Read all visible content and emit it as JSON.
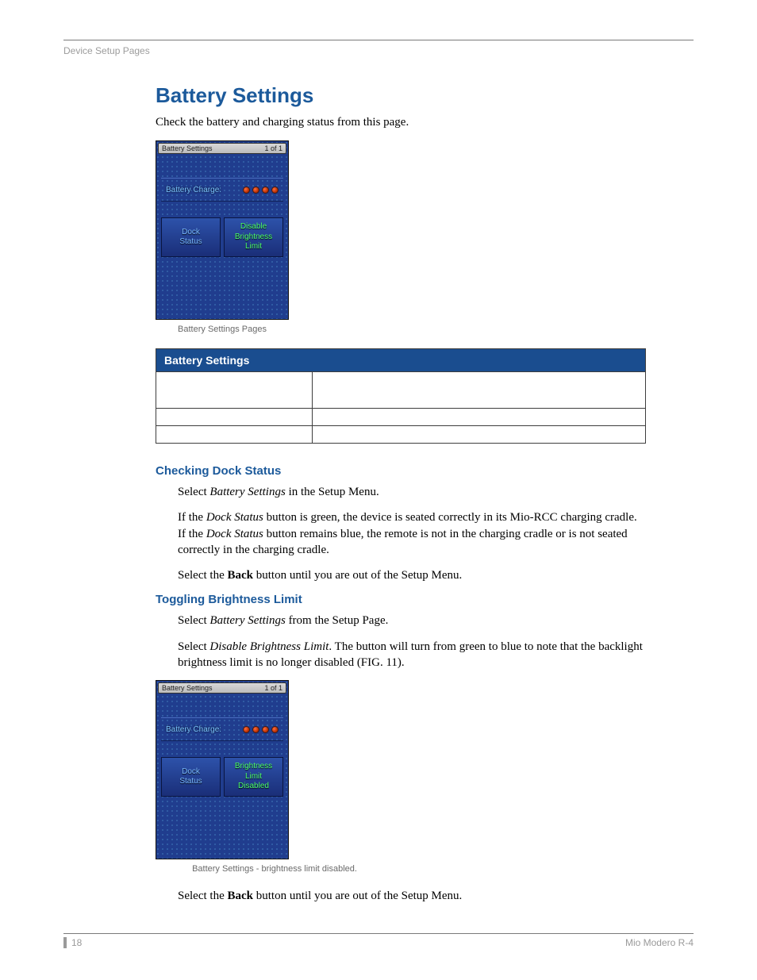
{
  "header": {
    "breadcrumb": "Device Setup Pages"
  },
  "title": "Battery Settings",
  "intro": "Check the battery and charging status from this page.",
  "figure1": {
    "titlebar_left": "Battery Settings",
    "titlebar_right": "1 of 1",
    "charge_label": "Battery Charge:",
    "btn_dock": "Dock\nStatus",
    "btn_bright": "Disable\nBrightness\nLimit",
    "caption": "Battery Settings Pages"
  },
  "table": {
    "header": "Battery Settings"
  },
  "section_check": {
    "heading": "Checking Dock Status",
    "p1_a": "Select ",
    "p1_em": "Battery Settings",
    "p1_b": " in the Setup Menu.",
    "p2_a": "If the ",
    "p2_em1": "Dock Status",
    "p2_b": " button is green, the device is seated correctly in its Mio-RCC charging cradle. If the ",
    "p2_em2": "Dock Status",
    "p2_c": " button remains blue, the remote is not in the charging cradle or is not seated correctly in the charging cradle.",
    "p3_a": "Select the ",
    "p3_strong": "Back",
    "p3_b": " button until you are out of the Setup Menu."
  },
  "section_toggle": {
    "heading": "Toggling Brightness Limit",
    "p1_a": "Select ",
    "p1_em": "Battery Settings",
    "p1_b": " from the Setup Page.",
    "p2_a": "Select ",
    "p2_em": "Disable Brightness Limit",
    "p2_b": ". The button will turn from green to blue to note that the backlight brightness limit is no longer disabled (FIG. 11)."
  },
  "figure2": {
    "titlebar_left": "Battery Settings",
    "titlebar_right": "1 of 1",
    "charge_label": "Battery Charge:",
    "btn_dock": "Dock\nStatus",
    "btn_bright": "Brightness\nLimit\nDisabled",
    "caption": "Battery Settings - brightness limit disabled."
  },
  "final": {
    "p_a": "Select the ",
    "p_strong": "Back",
    "p_b": " button until you are out of the Setup Menu."
  },
  "footer": {
    "page": "18",
    "doc": "Mio Modero R-4"
  }
}
